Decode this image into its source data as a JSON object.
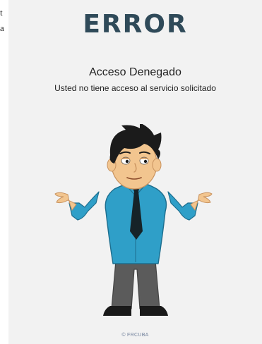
{
  "sidebar_fragments": [
    "t",
    "a"
  ],
  "error_page": {
    "title": "ERROR",
    "subtitle": "Acceso Denegado",
    "message": "Usted no tiene acceso al servicio solicitado",
    "illustration": "shrugging-man",
    "copyright": "© FRCUBA"
  },
  "colors": {
    "title": "#2f4a59",
    "panel_background": "#f2f2f2",
    "shirt": "#2f9fc8",
    "hair": "#1b1b1b",
    "pants": "#5b5b5b",
    "tie": "#162328"
  }
}
